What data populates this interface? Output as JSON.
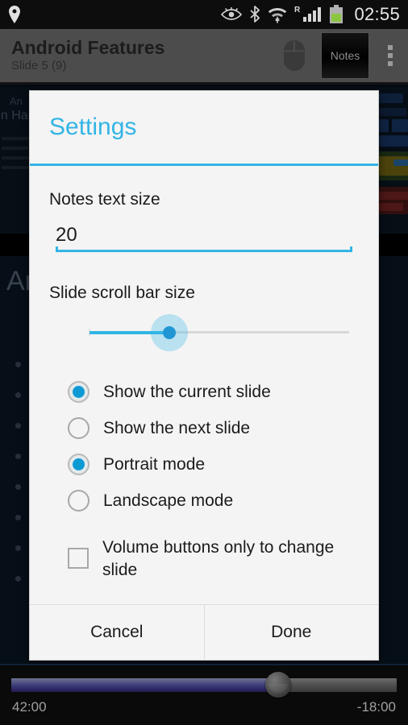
{
  "status_bar": {
    "location_icon": "location-pin-icon",
    "icons": [
      "eye-icon",
      "bluetooth-icon",
      "wifi-icon",
      "roaming-signal-icon",
      "battery-icon"
    ],
    "roaming_label": "R",
    "clock": "02:55"
  },
  "action_bar": {
    "title": "Android Features",
    "subtitle": "Slide 5 (9)",
    "pointer_icon": "mouse-pointer-icon",
    "notes_label": "Notes",
    "overflow_icon": "overflow-menu-icon"
  },
  "slide_background": {
    "top_title": "An",
    "top_subtitle": "en Hand",
    "heading": "An"
  },
  "dialog": {
    "title": "Settings",
    "notes_text_size": {
      "label": "Notes text size",
      "value": "20",
      "placeholder": "20"
    },
    "scroll_bar_size": {
      "label": "Slide scroll bar size",
      "value": 40,
      "min": 0,
      "max": 100
    },
    "choices": [
      {
        "label": "Show the current slide",
        "checked": true
      },
      {
        "label": "Show the next slide",
        "checked": false
      },
      {
        "label": "Portrait mode",
        "checked": true
      },
      {
        "label": "Landscape mode",
        "checked": false
      }
    ],
    "checkbox": {
      "label": "Volume buttons only to change slide",
      "checked": false
    },
    "buttons": {
      "cancel": "Cancel",
      "done": "Done"
    }
  },
  "player": {
    "elapsed": "42:00",
    "remaining": "-18:00",
    "progress": 70
  },
  "colors": {
    "accent": "#33b5e5",
    "dialog_bg": "#f4f4f4",
    "action_bar_bg": "#4c4c4c",
    "status_bar_bg": "#0d0d0d",
    "radio_fill": "#0d9ad4",
    "battery": "#8cc63f"
  }
}
